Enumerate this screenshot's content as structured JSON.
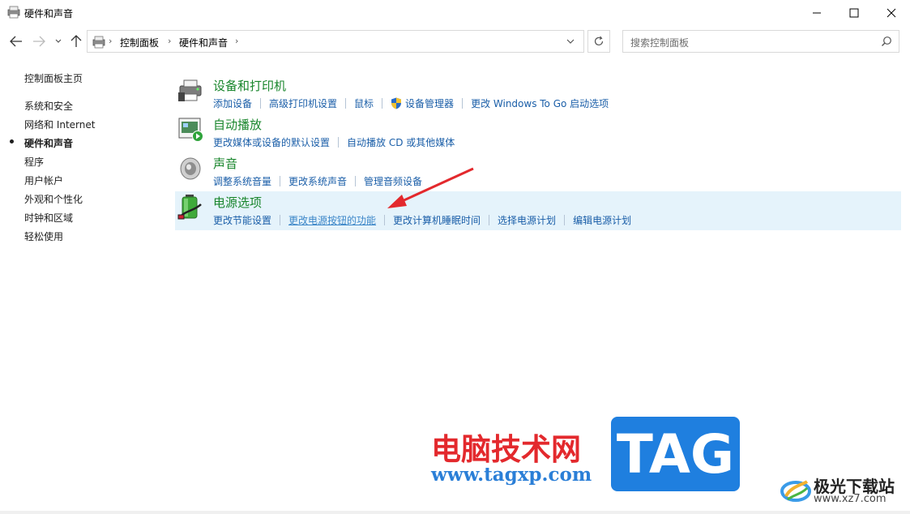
{
  "window": {
    "title": "硬件和声音"
  },
  "address": {
    "crumbs": [
      "控制面板",
      "硬件和声音"
    ]
  },
  "search": {
    "placeholder": "搜索控制面板"
  },
  "sidebar": {
    "home": "控制面板主页",
    "items": [
      {
        "label": "系统和安全"
      },
      {
        "label": "网络和 Internet"
      },
      {
        "label": "硬件和声音",
        "active": true
      },
      {
        "label": "程序"
      },
      {
        "label": "用户帐户"
      },
      {
        "label": "外观和个性化"
      },
      {
        "label": "时钟和区域"
      },
      {
        "label": "轻松使用"
      }
    ]
  },
  "categories": [
    {
      "title": "设备和打印机",
      "icon": "printer-icon",
      "links": [
        "添加设备",
        "高级打印机设置",
        "鼠标",
        "设备管理器",
        "更改 Windows To Go 启动选项"
      ]
    },
    {
      "title": "自动播放",
      "icon": "autoplay-icon",
      "links": [
        "更改媒体或设备的默认设置",
        "自动播放 CD 或其他媒体"
      ]
    },
    {
      "title": "声音",
      "icon": "speaker-icon",
      "links": [
        "调整系统音量",
        "更改系统声音",
        "管理音频设备"
      ]
    },
    {
      "title": "电源选项",
      "icon": "battery-icon",
      "links": [
        "更改节能设置",
        "更改电源按钮的功能",
        "更改计算机睡眠时间",
        "选择电源计划",
        "编辑电源计划"
      ]
    }
  ],
  "watermark": {
    "text": "电脑技术网",
    "url": "www.tagxp.com",
    "tag": "TAG",
    "brand": "极光下载站",
    "brand_url": "www.xz7.com"
  },
  "colors": {
    "category_title": "#19862c",
    "link": "#1a5ea8",
    "highlight": "#e5f3fb",
    "arrow": "#e3292d"
  }
}
